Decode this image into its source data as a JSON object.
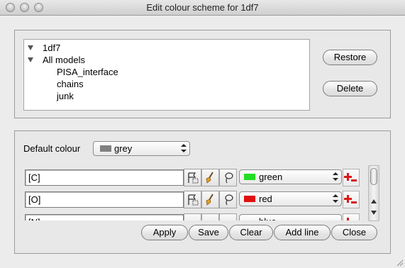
{
  "window": {
    "title": "Edit colour scheme for 1df7"
  },
  "tree": {
    "items": [
      {
        "label": "1df7",
        "expanded": true
      },
      {
        "label": "All models",
        "expanded": true
      },
      {
        "label": "PISA_interface"
      },
      {
        "label": "chains"
      },
      {
        "label": "junk"
      }
    ]
  },
  "side_buttons": {
    "restore": "Restore",
    "delete": "Delete"
  },
  "default_colour": {
    "label": "Default colour",
    "value": "grey",
    "swatch": "#808080"
  },
  "rules": [
    {
      "spec": "[C]",
      "colour": "green",
      "swatch": "#22dd22"
    },
    {
      "spec": "[O]",
      "colour": "red",
      "swatch": "#e01010"
    },
    {
      "spec": "[N]",
      "colour": "blue",
      "swatch": "#1010e0"
    }
  ],
  "actions": {
    "apply": "Apply",
    "save": "Save",
    "clear": "Clear",
    "add_line": "Add line",
    "close": "Close"
  },
  "icons": {
    "rule_buttons": [
      "selection-flag-icon",
      "brush-icon",
      "lasso-icon"
    ],
    "row_action": "add-remove-icon",
    "accent": "#d81a1a"
  }
}
